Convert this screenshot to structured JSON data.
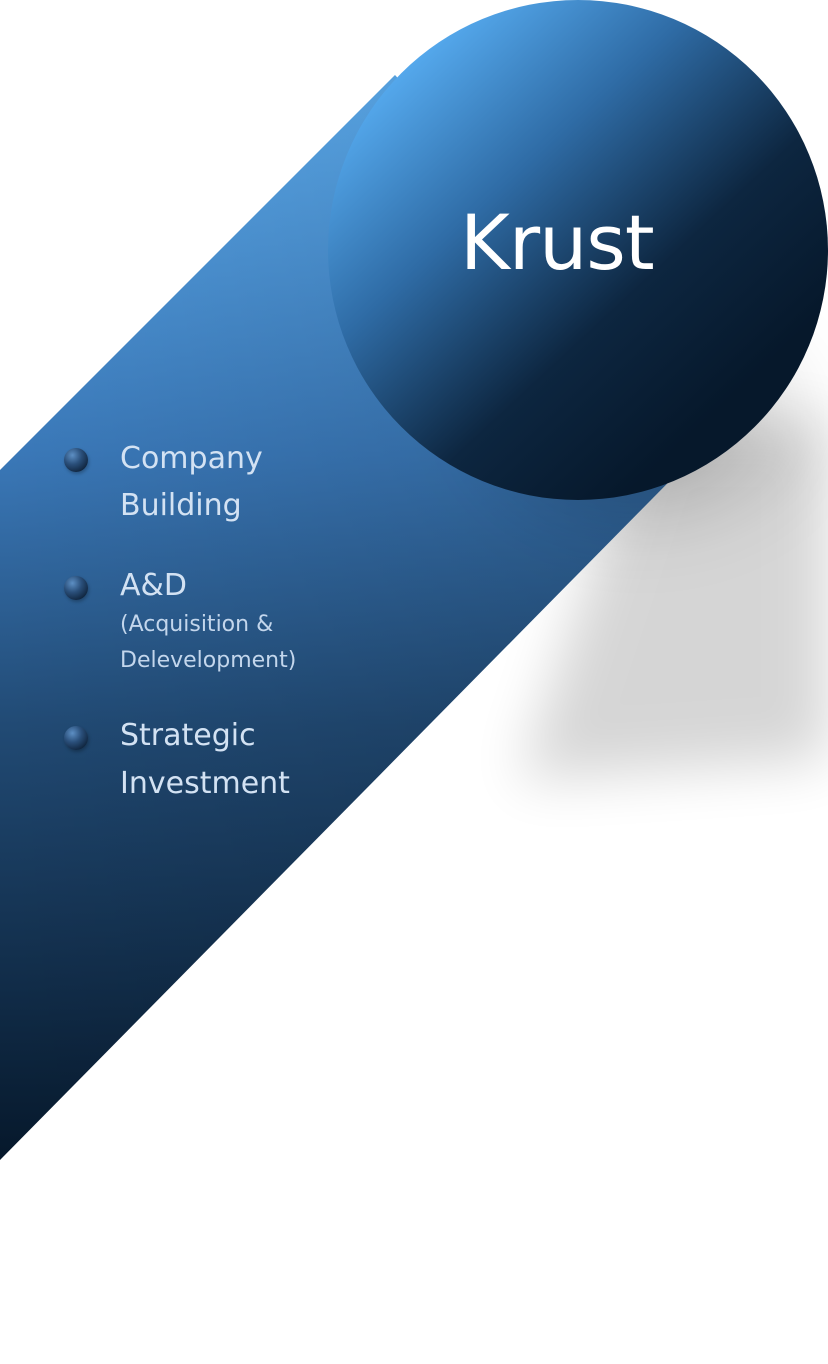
{
  "brand": {
    "logo_text": "Krust"
  },
  "services": [
    {
      "title_line1": "Company",
      "title_line2": "Building"
    },
    {
      "title": "A&D",
      "subtitle_line1": "(Acquisition &",
      "subtitle_line2": "Delevelopment)"
    },
    {
      "title_line1": "Strategic",
      "title_line2": "Investment"
    }
  ],
  "colors": {
    "band_light": "#58aef3",
    "band_mid": "#1f4a76",
    "band_dark": "#06182b",
    "text_light": "#d3e2f3"
  }
}
